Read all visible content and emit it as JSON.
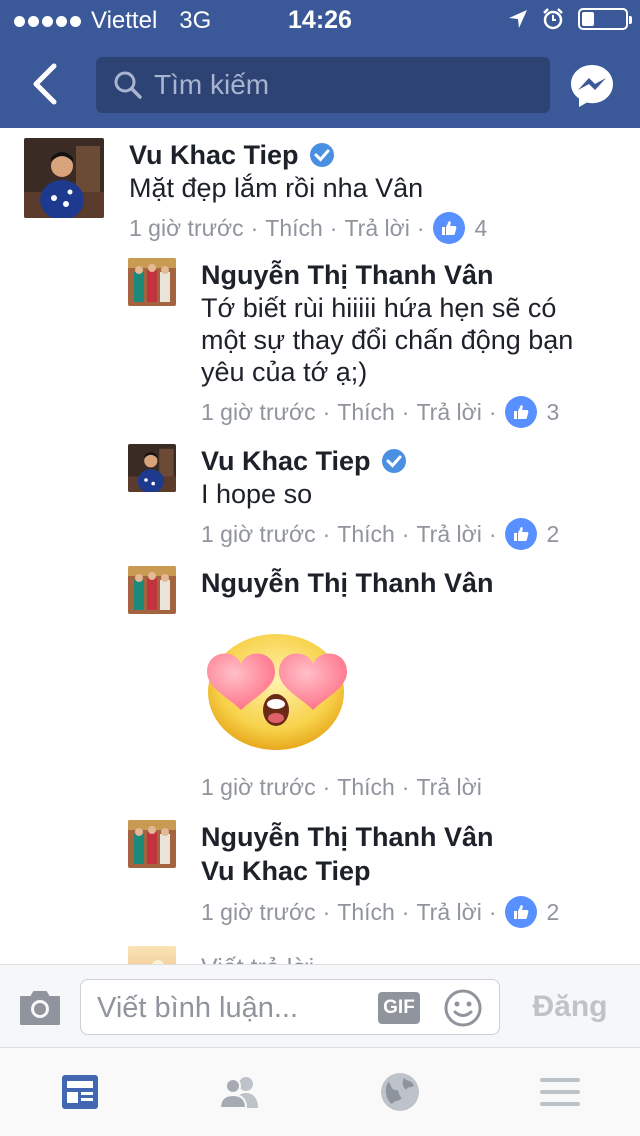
{
  "status_bar": {
    "carrier": "Viettel",
    "network": "3G",
    "time": "14:26",
    "battery_level": 0.28
  },
  "nav": {
    "search_placeholder": "Tìm kiếm",
    "icons": [
      "back-chevron-icon",
      "search-icon",
      "messenger-icon"
    ]
  },
  "comments": [
    {
      "author": "Vu Khac Tiep",
      "verified": true,
      "text": "Mặt đẹp lắm rồi nha Vân",
      "time": "1 giờ trước",
      "like_label": "Thích",
      "reply_label": "Trả lời",
      "likes": "4"
    },
    {
      "author": "Nguyễn Thị Thanh Vân",
      "text_lines": [
        "Tớ biết rùi hiiiii hứa hẹn sẽ có",
        "một sự thay đổi chấn động bạn",
        "yêu của tớ ạ;)"
      ],
      "time": "1 giờ trước",
      "like_label": "Thích",
      "reply_label": "Trả lời",
      "likes": "3"
    },
    {
      "author": "Vu Khac Tiep",
      "verified": true,
      "text": "I hope so",
      "time": "1 giờ trước",
      "like_label": "Thích",
      "reply_label": "Trả lời",
      "likes": "2"
    },
    {
      "author": "Nguyễn Thị Thanh Vân",
      "sticker": "heart-eyes-emoji",
      "time": "1 giờ trước",
      "like_label": "Thích",
      "reply_label": "Trả lời"
    },
    {
      "author": "Nguyễn Thị Thanh Vân",
      "text": "Vu Khac Tiep",
      "time": "1 giờ trước",
      "like_label": "Thích",
      "reply_label": "Trả lời",
      "likes": "2"
    }
  ],
  "reply_prompt": "Viết trả lời",
  "compose": {
    "placeholder": "Viết bình luận...",
    "gif_label": "GIF",
    "post_label": "Đăng"
  },
  "tabs": [
    "news-feed-icon",
    "friends-icon",
    "globe-icon",
    "menu-icon"
  ],
  "colors": {
    "brand": "#3b5998",
    "like_blue": "#5890ff",
    "meta_gray": "#90949c"
  }
}
